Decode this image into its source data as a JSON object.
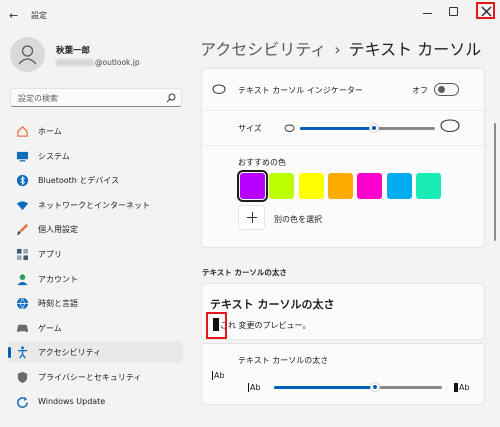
{
  "window": {
    "title": "設定",
    "back_icon": "back-arrow-icon"
  },
  "user": {
    "name": "秋葉一郎",
    "email_suffix": "@outlook.jp"
  },
  "search": {
    "placeholder": "設定の検索"
  },
  "nav": [
    {
      "label": "ホーム",
      "icon": "home-icon",
      "color": "#e8743b"
    },
    {
      "label": "システム",
      "icon": "monitor-icon",
      "color": "#0f6cbd"
    },
    {
      "label": "Bluetooth とデバイス",
      "icon": "bluetooth-icon",
      "color": "#0f6cbd"
    },
    {
      "label": "ネットワークとインターネット",
      "icon": "wifi-icon",
      "color": "#0f6cbd"
    },
    {
      "label": "個人用設定",
      "icon": "brush-icon",
      "color": "#e8743b"
    },
    {
      "label": "アプリ",
      "icon": "apps-icon",
      "color": "#445a73"
    },
    {
      "label": "アカウント",
      "icon": "account-icon",
      "color": "#2c9e5b"
    },
    {
      "label": "時刻と言語",
      "icon": "globe-clock-icon",
      "color": "#0f6cbd"
    },
    {
      "label": "ゲーム",
      "icon": "gamepad-icon",
      "color": "#6b6b6b"
    },
    {
      "label": "アクセシビリティ",
      "icon": "accessibility-icon",
      "color": "#0f6cbd",
      "active": true
    },
    {
      "label": "プライバシーとセキュリティ",
      "icon": "shield-icon",
      "color": "#6b6b6b"
    },
    {
      "label": "Windows Update",
      "icon": "update-icon",
      "color": "#0f6cbd"
    }
  ],
  "breadcrumb": {
    "parent": "アクセシビリティ",
    "separator": "›",
    "current": "テキスト カーソル"
  },
  "indicator": {
    "label": "テキスト カーソル インジケーター",
    "toggle_state": "オフ",
    "toggle_on": false,
    "size_label": "サイズ",
    "size_value": 0.55,
    "recommended_colors_label": "おすすめの色",
    "colors": [
      "#b700fe",
      "#bdfe00",
      "#fefe00",
      "#ffaa00",
      "#fe00cc",
      "#00aef0",
      "#19ebb5"
    ],
    "selected_color_index": 0,
    "choose_other_label": "別の色を選択"
  },
  "thickness_section": {
    "header": "テキスト カーソルの太さ",
    "preview_title": "テキスト カーソルの太さ",
    "preview_text": "これ 変更のプレビュー。",
    "slider_label": "テキスト カーソルの太さ",
    "left_glyph": "Ab",
    "right_glyph": "Ab",
    "value": 0.6
  },
  "highlight_color": "#e3171b",
  "accent_color": "#005fb8"
}
